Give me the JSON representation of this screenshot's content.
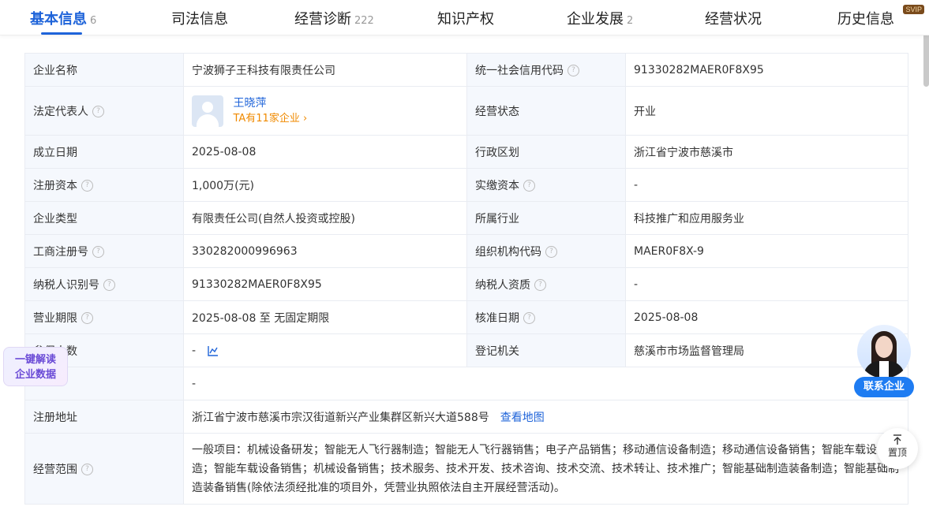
{
  "tabs": [
    {
      "label": "基本信息",
      "count": "6"
    },
    {
      "label": "司法信息",
      "count": ""
    },
    {
      "label": "经营诊断",
      "count": "222"
    },
    {
      "label": "知识产权",
      "count": ""
    },
    {
      "label": "企业发展",
      "count": "2"
    },
    {
      "label": "经营状况",
      "count": ""
    },
    {
      "label": "历史信息",
      "count": ""
    }
  ],
  "svip_badge": "SVIP",
  "rows": {
    "company_name": {
      "label": "企业名称",
      "value": "宁波狮子王科技有限责任公司"
    },
    "credit_code": {
      "label": "统一社会信用代码",
      "value": "91330282MAER0F8X95"
    },
    "legal_rep": {
      "label": "法定代表人",
      "name": "王晓萍",
      "link": "TA有11家企业 ›"
    },
    "status": {
      "label": "经营状态",
      "value": "开业"
    },
    "founded": {
      "label": "成立日期",
      "value": "2025-08-08"
    },
    "region": {
      "label": "行政区划",
      "value": "浙江省宁波市慈溪市"
    },
    "reg_capital": {
      "label": "注册资本",
      "value": "1,000万(元)"
    },
    "paid_capital": {
      "label": "实缴资本",
      "value": "-"
    },
    "company_type": {
      "label": "企业类型",
      "value": "有限责任公司(自然人投资或控股)"
    },
    "industry": {
      "label": "所属行业",
      "value": "科技推广和应用服务业"
    },
    "reg_no": {
      "label": "工商注册号",
      "value": "330282000996963"
    },
    "org_code": {
      "label": "组织机构代码",
      "value": "MAER0F8X-9"
    },
    "taxpayer_id": {
      "label": "纳税人识别号",
      "value": "91330282MAER0F8X95"
    },
    "taxpayer_qual": {
      "label": "纳税人资质",
      "value": "-"
    },
    "term": {
      "label": "营业期限",
      "value": "2025-08-08 至 无固定期限"
    },
    "approval_date": {
      "label": "核准日期",
      "value": "2025-08-08"
    },
    "insured": {
      "label": "参保人数",
      "value": "-"
    },
    "authority": {
      "label": "登记机关",
      "value": "慈溪市市场监督管理局"
    },
    "blank_row": {
      "label": "",
      "value": "-"
    },
    "address": {
      "label": "注册地址",
      "value": "浙江省宁波市慈溪市宗汉街道新兴产业集群区新兴大道588号",
      "link": "查看地图"
    },
    "scope": {
      "label": "经营范围",
      "value": "一般项目：机械设备研发；智能无人飞行器制造；智能无人飞行器销售；电子产品销售；移动通信设备制造；移动通信设备销售；智能车载设备制造；智能车载设备销售；机械设备销售；技术服务、技术开发、技术咨询、技术交流、技术转让、技术推广；智能基础制造装备制造；智能基础制造装备销售(除依法须经批准的项目外，凭营业执照依法自主开展经营活动)。"
    }
  },
  "ai_card": {
    "line1": "一键解读",
    "line2": "企业数据"
  },
  "contact_button": "联系企业",
  "to_top": "置顶"
}
